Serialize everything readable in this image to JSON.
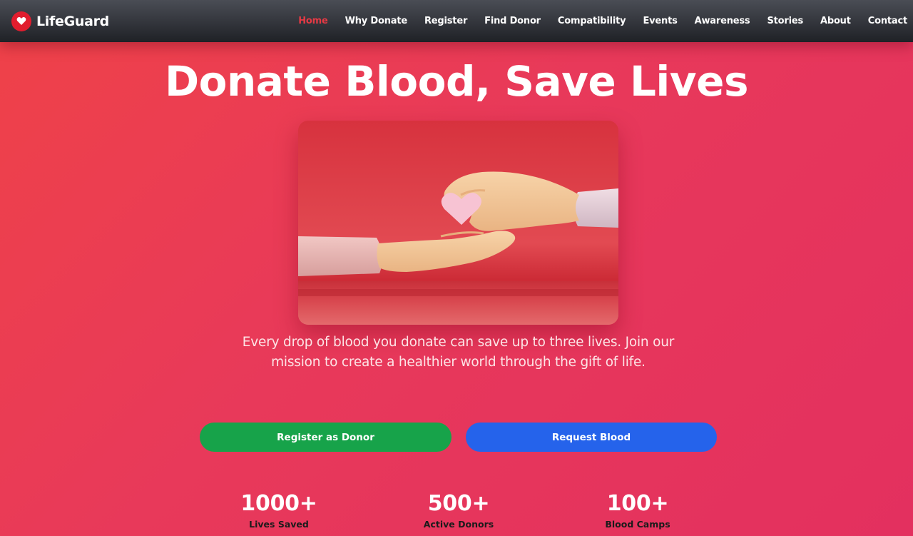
{
  "brand": {
    "name": "LifeGuard",
    "logo_icon": "heart-icon",
    "logo_color": "#e11d2e"
  },
  "nav": {
    "items": [
      {
        "label": "Home",
        "active": true
      },
      {
        "label": "Why Donate"
      },
      {
        "label": "Register"
      },
      {
        "label": "Find Donor"
      },
      {
        "label": "Compatibility"
      },
      {
        "label": "Events"
      },
      {
        "label": "Awareness"
      },
      {
        "label": "Stories"
      },
      {
        "label": "About"
      },
      {
        "label": "Contact"
      }
    ],
    "active_color": "#e53944"
  },
  "hero": {
    "title": "Donate Blood, Save Lives",
    "description": "Every drop of blood you donate can save up to three lives. Join our mission to create a healthier world through the gift of life.",
    "image_icon": "hands-giving-heart-illustration"
  },
  "buttons": {
    "register": {
      "label": "Register as Donor",
      "color": "#17a34a"
    },
    "request": {
      "label": "Request Blood",
      "color": "#2563eb"
    }
  },
  "stats": [
    {
      "value": "1000+",
      "label": "Lives Saved"
    },
    {
      "value": "500+",
      "label": "Active Donors"
    },
    {
      "value": "100+",
      "label": "Blood Camps"
    }
  ]
}
